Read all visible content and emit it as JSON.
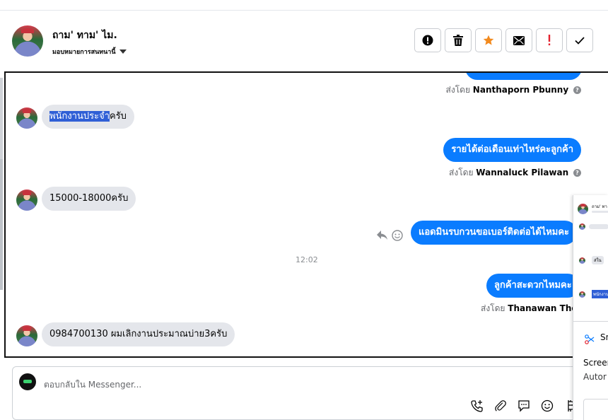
{
  "conversation": {
    "contact_name": "ถาม' ทาม' ไม.",
    "assign_label": "มอบหมายการสนทนานี้"
  },
  "actions": [
    {
      "name": "report-button",
      "icon": "alert-circle-icon",
      "color": "#050505"
    },
    {
      "name": "delete-button",
      "icon": "trash-icon",
      "color": "#050505"
    },
    {
      "name": "star-button",
      "icon": "star-icon",
      "color": "#f28a1e"
    },
    {
      "name": "mark-unread-button",
      "icon": "envelope-icon",
      "color": "#050505"
    },
    {
      "name": "follow-up-button",
      "icon": "exclamation-icon",
      "color": "#e4222f"
    },
    {
      "name": "done-button",
      "icon": "check-icon",
      "color": "#050505"
    }
  ],
  "messages": {
    "m1_sender_prefix": "ส่งโดย",
    "m1_sender": "Nanthaporn Pbunny",
    "m2_highlight": "พนักงานประจำ",
    "m2_rest": "ครับ",
    "m3_text": "รายได้ต่อเดือนเท่าไหร่คะลูกค้า",
    "m3_sender_prefix": "ส่งโดย",
    "m3_sender": "Wannaluck Pilawan",
    "m4_text": "15000-18000ครับ",
    "m5_text": "แอดมินรบกวนขอเบอร์ติดต่อได้ไหมคะ",
    "time": "12:02",
    "m6_text": "ลูกค้าสะดวกไหมคะ",
    "m6_sender_prefix": "ส่งโดย",
    "m6_sender": "Thanawan Thon",
    "m7_text": "0984700130 ผมเลิกงานประมาณบ่าย3ครับ"
  },
  "reply": {
    "placeholder": "ตอบกลับใน Messenger..."
  },
  "overlay": {
    "thumb_name": "ถาม' ทา",
    "thumb_msg1": "ส่ใน",
    "thumb_msg2": "พนักงาน",
    "line1": "Sn",
    "line2": "Screen",
    "line3": "Autor"
  },
  "colors": {
    "accent": "#0a7cff",
    "incoming_bubble": "#e4e6eb",
    "selection_highlight": "#2f5fd6"
  }
}
